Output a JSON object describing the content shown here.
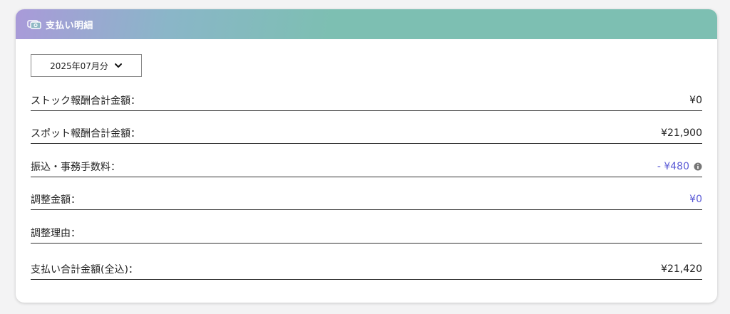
{
  "header": {
    "title": "支払い明細",
    "icon": "money-icon"
  },
  "month_select": {
    "value": "2025年07月分",
    "icon": "chevron-down-icon"
  },
  "rows": [
    {
      "label": "ストック報酬合計金額：",
      "value": "¥0"
    },
    {
      "label": "スポット報酬合計金額：",
      "value": "¥21,900"
    },
    {
      "label": "振込・事務手数料：",
      "value": "- ¥480",
      "icon": "info-icon"
    },
    {
      "label": "調整金額：",
      "value": "¥0"
    },
    {
      "label": "調整理由：",
      "value": ""
    },
    {
      "label": "支払い合計金額(全込)：",
      "value": "¥21,420"
    }
  ],
  "colors": {
    "accent": "#5b5bd6",
    "header_start": "#a99ad9",
    "header_end": "#7dbfb2"
  }
}
